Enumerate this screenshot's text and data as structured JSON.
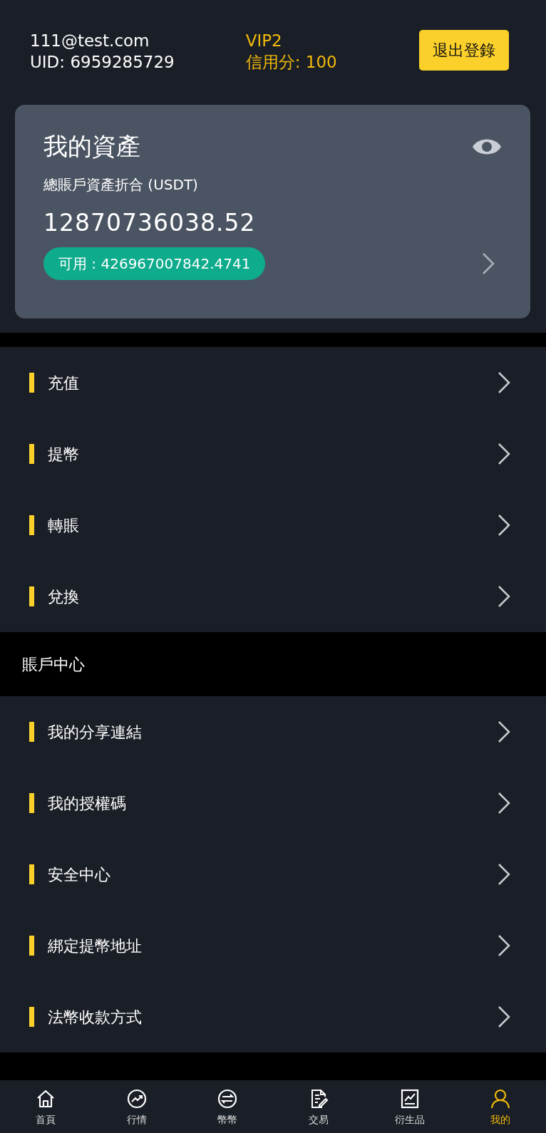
{
  "user": {
    "email": "111@test.com",
    "uid": "UID: 6959285729",
    "vip": "VIP2",
    "credit": "信用分: 100",
    "logout": "退出登錄"
  },
  "assets": {
    "title": "我的資產",
    "subtitle": "總賬戶資產折合 (USDT)",
    "total": "12870736038.52",
    "available": "可用 : 426967007842.4741"
  },
  "groups": [
    {
      "items": [
        {
          "label": "充值"
        },
        {
          "label": "提幣"
        },
        {
          "label": "轉賬"
        },
        {
          "label": "兌換"
        }
      ]
    },
    {
      "title": "賬戶中心",
      "items": [
        {
          "label": "我的分享連結"
        },
        {
          "label": "我的授權碼"
        },
        {
          "label": "安全中心"
        },
        {
          "label": "綁定提幣地址"
        },
        {
          "label": "法幣收款方式"
        }
      ]
    }
  ],
  "tabs": [
    {
      "label": "首頁",
      "kind": "home",
      "selected": false
    },
    {
      "label": "行情",
      "kind": "market",
      "selected": false
    },
    {
      "label": "幣幣",
      "kind": "exchange",
      "selected": false
    },
    {
      "label": "交易",
      "kind": "trade",
      "selected": false
    },
    {
      "label": "衍生品",
      "kind": "derivatives",
      "selected": false
    },
    {
      "label": "我的",
      "kind": "profile",
      "selected": true
    }
  ]
}
